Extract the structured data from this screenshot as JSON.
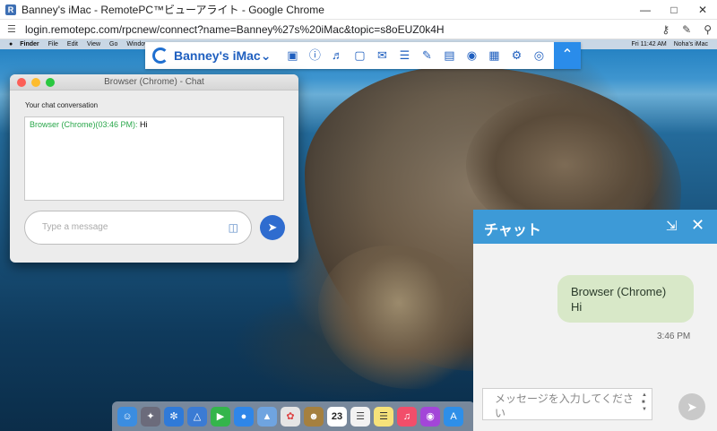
{
  "browser": {
    "window_title": "Banney's iMac - RemotePC™ビューアライト - Google Chrome",
    "app_badge": "R",
    "url": "login.remotepc.com/rpcnew/connect?name=Banney%27s%20iMac&topic=s8oEUZ0k4H"
  },
  "mac_menubar": {
    "items": [
      "Finder",
      "File",
      "Edit",
      "View",
      "Go",
      "Window"
    ],
    "clock": "Fri 11:42 AM",
    "user": "Noha's iMac"
  },
  "rpc_toolbar": {
    "machine_name": "Banney's iMac",
    "icons": [
      "disconnect-icon",
      "info-icon",
      "sound-icon",
      "fullscreen-icon",
      "chat-icon",
      "messages-icon",
      "whiteboard-icon",
      "file-transfer-icon",
      "screenshot-icon",
      "notes-icon",
      "settings-icon",
      "view-icon",
      "help-icon",
      "collapse-icon"
    ]
  },
  "mac_chat": {
    "window_title": "Browser (Chrome) - Chat",
    "conversation_label": "Your chat conversation",
    "message_sender": "Browser (Chrome)(03:46 PM):",
    "message_text": " Hi",
    "input_placeholder": "Type a message"
  },
  "side_chat": {
    "title": "チャット",
    "bubble_sender": "Browser (Chrome)",
    "bubble_text": "Hi",
    "bubble_time": "3:46 PM",
    "input_placeholder": "メッセージを入力してください"
  },
  "colors": {
    "accent_blue": "#3d9ad7",
    "rpc_blue": "#1f5fbf",
    "bubble_green": "#d8e8c8",
    "sender_green": "#29a74a"
  }
}
